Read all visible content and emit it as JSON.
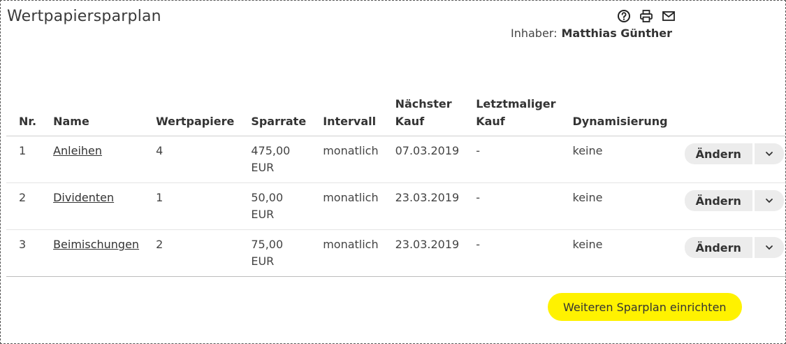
{
  "page": {
    "title": "Wertpapiersparplan",
    "owner_label": "Inhaber:",
    "owner_name": "Matthias Günther"
  },
  "toolbar_icons": [
    "help-icon",
    "print-icon",
    "mail-icon"
  ],
  "table": {
    "headers": {
      "nr": "Nr.",
      "name": "Name",
      "securities": "Wertpapiere",
      "rate": "Sparrate",
      "interval": "Intervall",
      "next_purchase": "Nächster Kauf",
      "last_purchase": "Letztmaliger Kauf",
      "dynamization": "Dynamisierung"
    },
    "rows": [
      {
        "nr": "1",
        "name": "Anleihen",
        "securities": "4",
        "rate": "475,00 EUR",
        "interval": "monatlich",
        "next_purchase": "07.03.2019",
        "last_purchase": "-",
        "dynamization": "keine",
        "action": "Ändern"
      },
      {
        "nr": "2",
        "name": "Dividenten",
        "securities": "1",
        "rate": "50,00 EUR",
        "interval": "monatlich",
        "next_purchase": "23.03.2019",
        "last_purchase": "-",
        "dynamization": "keine",
        "action": "Ändern"
      },
      {
        "nr": "3",
        "name": "Beimischungen",
        "securities": "2",
        "rate": "75,00 EUR",
        "interval": "monatlich",
        "next_purchase": "23.03.2019",
        "last_purchase": "-",
        "dynamization": "keine",
        "action": "Ändern"
      }
    ]
  },
  "cta_label": "Weiteren Sparplan einrichten",
  "colors": {
    "cta": "#fff200",
    "button_bg": "#ececec",
    "text": "#333333"
  }
}
